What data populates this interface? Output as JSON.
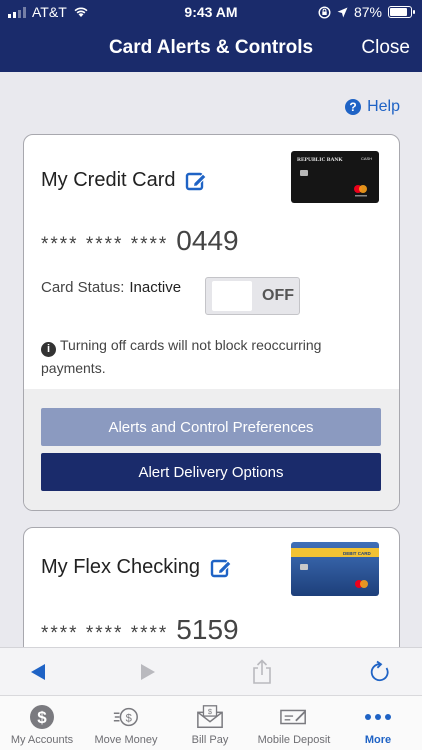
{
  "status_bar": {
    "carrier": "AT&T",
    "time": "9:43 AM",
    "battery": "87%",
    "battery_level": 0.87
  },
  "nav": {
    "title": "Card Alerts & Controls",
    "close_label": "Close"
  },
  "help_label": "Help",
  "cards": [
    {
      "name": "My Credit Card",
      "masked": "**** **** ****",
      "last4": "0449",
      "status_label": "Card Status:",
      "status_value": "Inactive",
      "toggle_label": "OFF",
      "info_text": "Turning off cards will not block reoccurring payments.",
      "image": {
        "brand": "REPUBLIC BANK",
        "tag": "CASH"
      },
      "buttons": {
        "preferences": "Alerts and Control Preferences",
        "delivery": "Alert Delivery Options"
      }
    },
    {
      "name": "My Flex Checking",
      "masked": "**** **** ****",
      "last4": "5159",
      "image": {
        "tag": "DEBIT CARD"
      }
    }
  ],
  "colors": {
    "header": "#1a2b6b",
    "accent": "#1f63c5",
    "button_primary": "#1a2b6b",
    "button_secondary": "#8b9ac0"
  },
  "browser_bar": [
    "back-icon",
    "forward-icon",
    "share-icon",
    "refresh-icon"
  ],
  "tabs": [
    {
      "label": "My Accounts",
      "icon": "dollar-circle-icon"
    },
    {
      "label": "Move Money",
      "icon": "transfer-icon"
    },
    {
      "label": "Bill Pay",
      "icon": "bill-envelope-icon"
    },
    {
      "label": "Mobile Deposit",
      "icon": "check-deposit-icon"
    },
    {
      "label": "More",
      "icon": "more-dots-icon",
      "active": true
    }
  ]
}
